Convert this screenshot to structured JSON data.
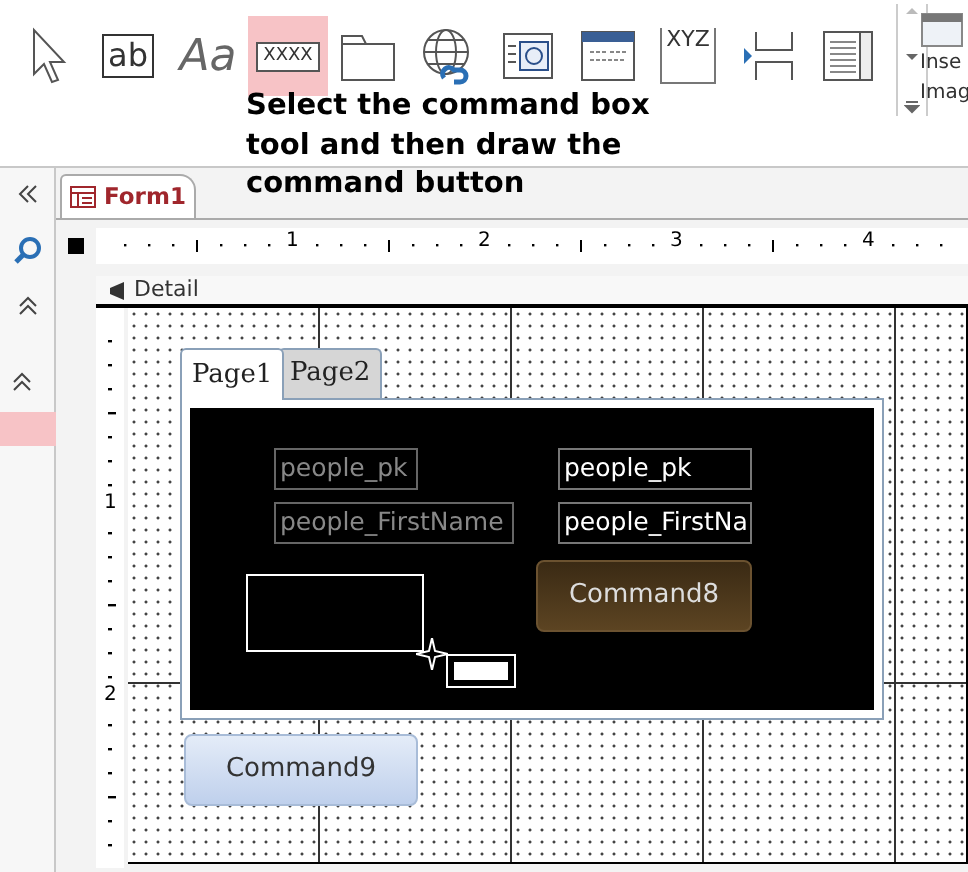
{
  "ribbon": {
    "tools": [
      {
        "kind": "pointer",
        "selected": false
      },
      {
        "kind": "textbox",
        "label": "ab",
        "selected": false
      },
      {
        "kind": "label",
        "label": "Aa",
        "selected": false
      },
      {
        "kind": "button",
        "label": "XXXX",
        "selected": true
      },
      {
        "kind": "tab",
        "selected": false
      },
      {
        "kind": "hyperlink",
        "selected": false
      },
      {
        "kind": "browser",
        "selected": false
      },
      {
        "kind": "navigation",
        "selected": false
      },
      {
        "kind": "option-group",
        "label": "XYZ",
        "selected": false
      },
      {
        "kind": "page-break",
        "selected": false
      },
      {
        "kind": "combo",
        "selected": false
      }
    ],
    "side_button": {
      "lines": [
        "Inse",
        "Imag"
      ]
    }
  },
  "annotation": "Select the command box tool and then draw the command button",
  "document_tab": {
    "title": "Form1",
    "selected": true
  },
  "ruler": {
    "numbers": [
      "1",
      "2",
      "3",
      "4"
    ]
  },
  "vertical_ruler": {
    "numbers": [
      "1",
      "2"
    ]
  },
  "section": {
    "title": "Detail"
  },
  "tab_control": {
    "pages": [
      {
        "label": "Page1",
        "selected": true
      },
      {
        "label": "Page2",
        "selected": false
      }
    ],
    "controls": [
      {
        "kind": "label",
        "text": "people_pk"
      },
      {
        "kind": "textbox",
        "text": "people_pk"
      },
      {
        "kind": "label",
        "text": "people_FirstName"
      },
      {
        "kind": "textbox",
        "text": "people_FirstNa"
      },
      {
        "kind": "button",
        "text": "Command8"
      },
      {
        "kind": "drawing"
      }
    ]
  },
  "form_controls": [
    {
      "kind": "button",
      "text": "Command9"
    }
  ]
}
